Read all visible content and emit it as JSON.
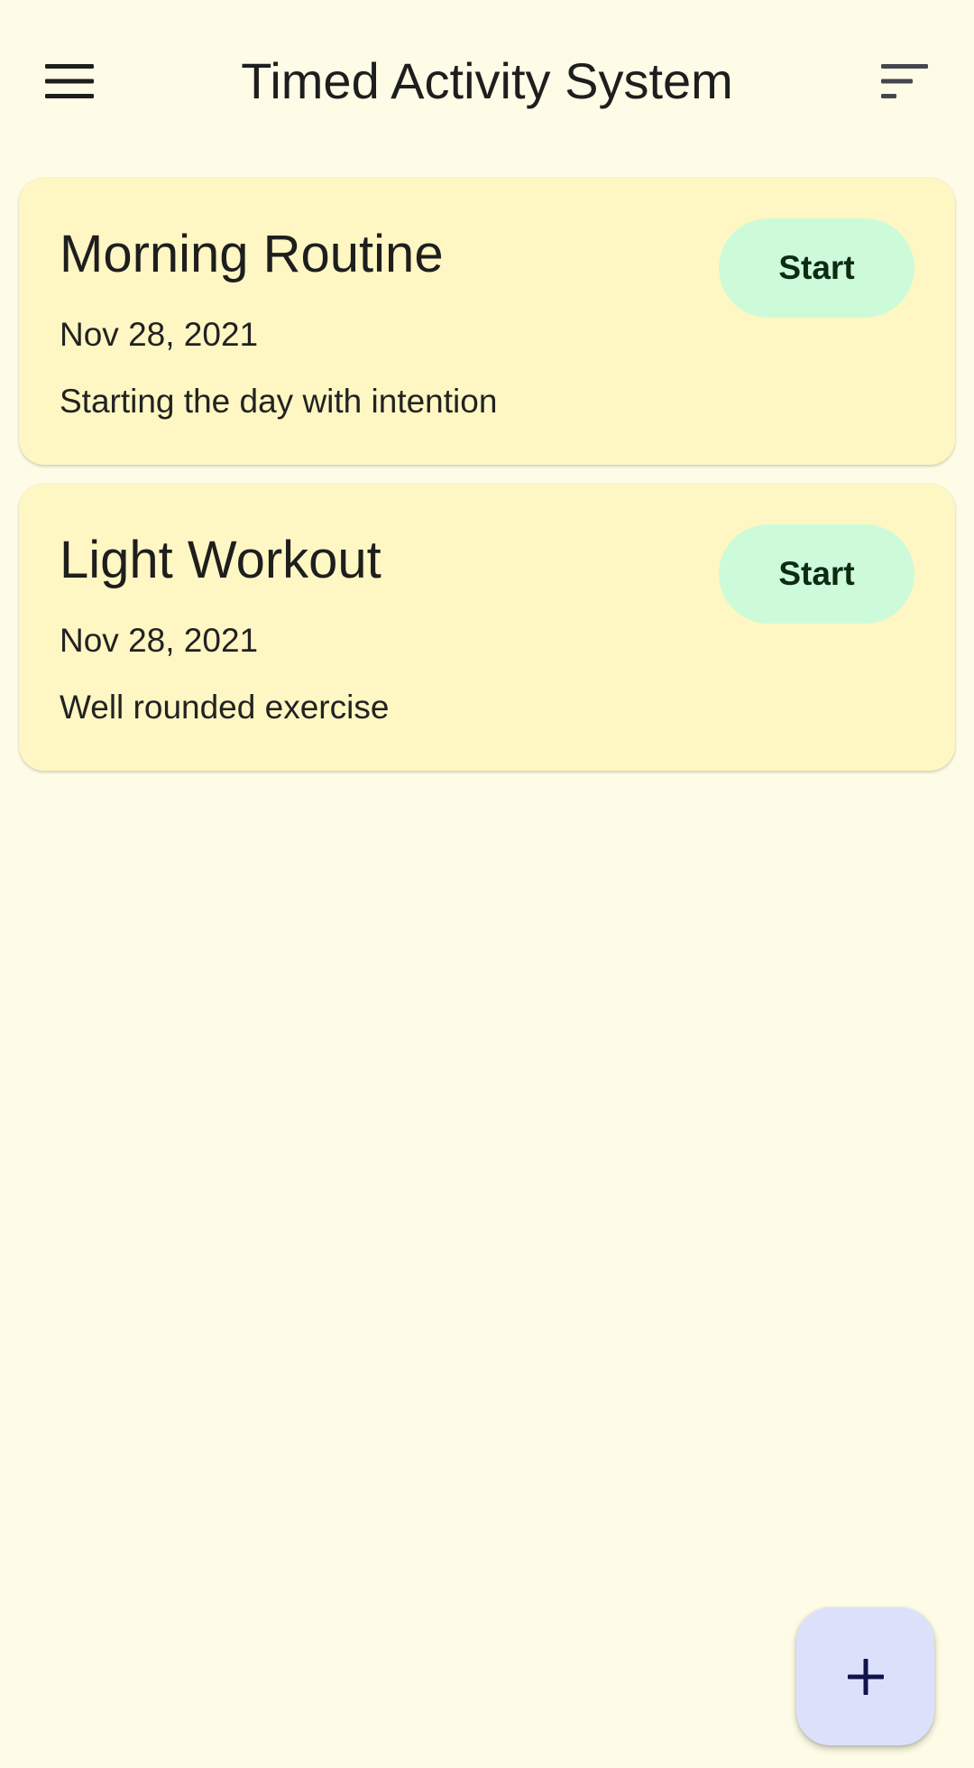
{
  "app": {
    "title": "Timed Activity System"
  },
  "icons": {
    "menu": "hamburger-menu-icon",
    "sort": "sort-icon",
    "add": "plus-icon"
  },
  "colors": {
    "background": "#FEFCE6",
    "card": "#FEF7C3",
    "start_button": "#CDFBD9",
    "fab": "#DCE1FB",
    "fab_icon": "#10124A"
  },
  "activities": [
    {
      "title": "Morning Routine",
      "date": "Nov 28, 2021",
      "description": "Starting the day with intention",
      "action_label": "Start"
    },
    {
      "title": "Light Workout",
      "date": "Nov 28, 2021",
      "description": "Well rounded exercise",
      "action_label": "Start"
    }
  ]
}
